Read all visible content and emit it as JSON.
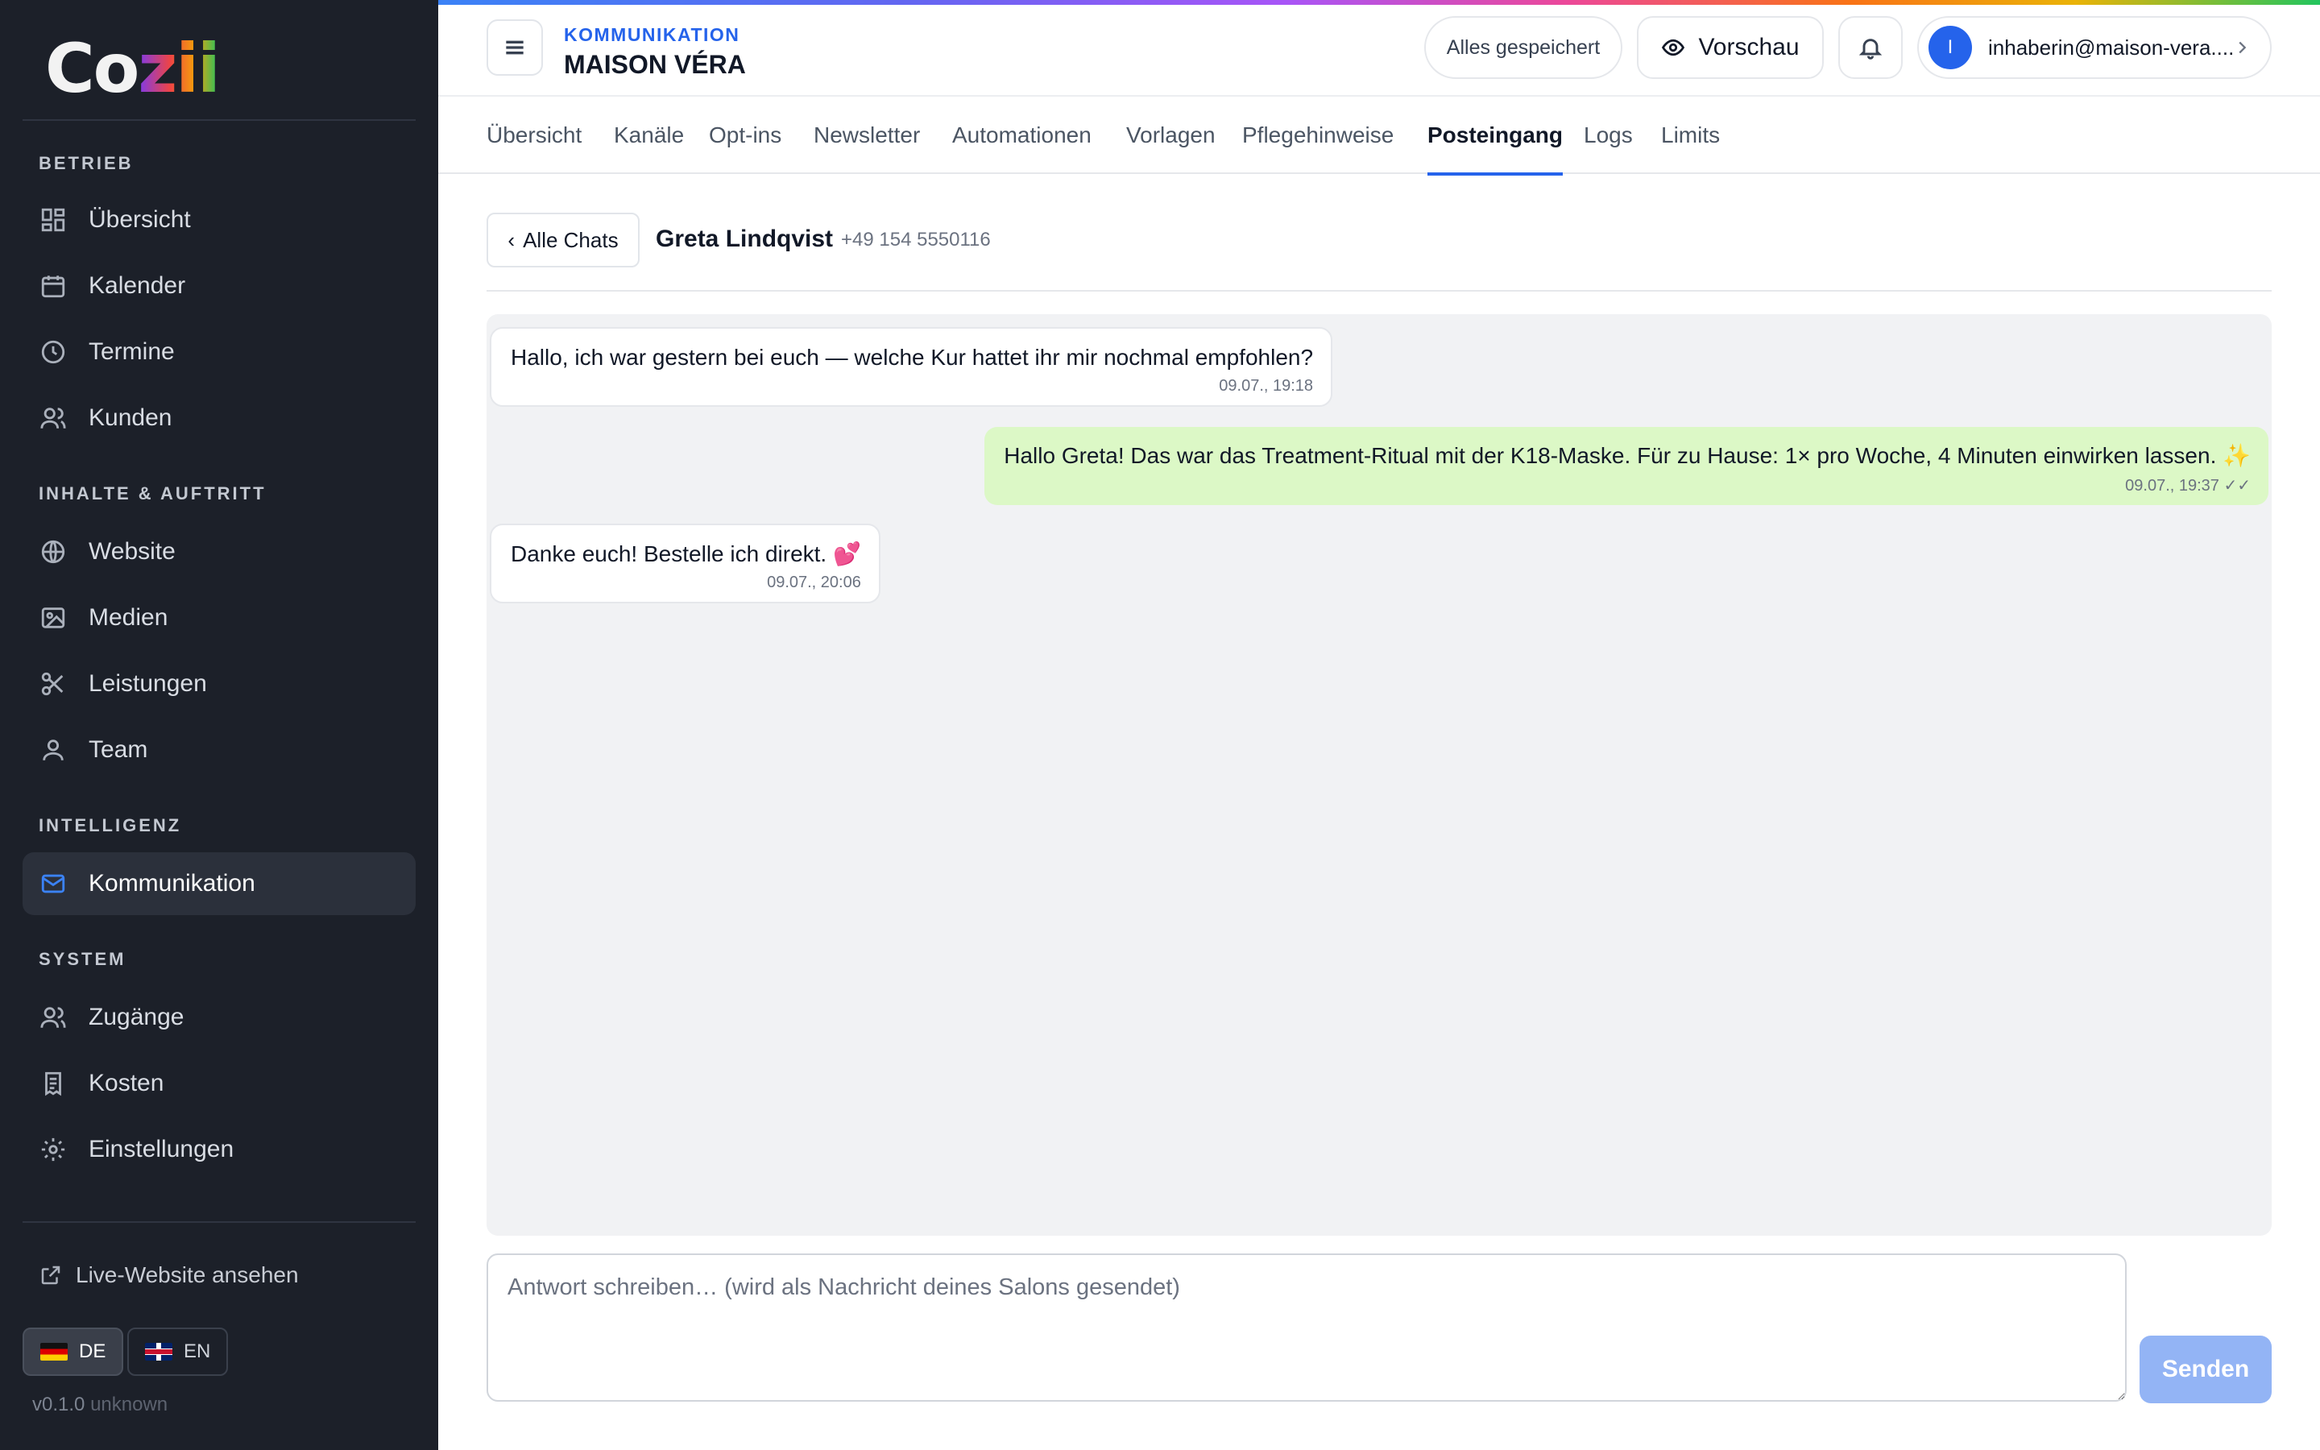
{
  "brand": {
    "logo_prefix": "Co",
    "logo_suffix": "zii"
  },
  "sidebar": {
    "sections": [
      {
        "title": "BETRIEB"
      },
      {
        "title": "INHALTE & AUFTRITT"
      },
      {
        "title": "INTELLIGENZ"
      },
      {
        "title": "SYSTEM"
      }
    ],
    "items": [
      {
        "label": "Übersicht",
        "icon": "dashboard-icon"
      },
      {
        "label": "Kalender",
        "icon": "calendar-icon"
      },
      {
        "label": "Termine",
        "icon": "clock-icon"
      },
      {
        "label": "Kunden",
        "icon": "users-icon"
      },
      {
        "label": "Website",
        "icon": "globe-icon"
      },
      {
        "label": "Medien",
        "icon": "image-icon"
      },
      {
        "label": "Leistungen",
        "icon": "scissors-icon"
      },
      {
        "label": "Team",
        "icon": "user-icon"
      },
      {
        "label": "Kommunikation",
        "icon": "mail-icon",
        "active": true
      },
      {
        "label": "Zugänge",
        "icon": "users-icon"
      },
      {
        "label": "Kosten",
        "icon": "receipt-icon"
      },
      {
        "label": "Einstellungen",
        "icon": "gear-icon"
      }
    ],
    "live_link": "Live-Website ansehen",
    "languages": [
      {
        "code": "DE",
        "active": true
      },
      {
        "code": "EN",
        "active": false
      }
    ],
    "version": "v0.1.0",
    "version_suffix": "unknown"
  },
  "topbar": {
    "section_label": "KOMMUNIKATION",
    "title": "MAISON VÉRA",
    "save_status": "Alles gespeichert",
    "preview_label": "Vorschau",
    "user_initial": "I",
    "user_email": "inhaberin@maison-vera...."
  },
  "tabs": [
    {
      "label": "Übersicht"
    },
    {
      "label": "Kanäle"
    },
    {
      "label": "Opt-ins"
    },
    {
      "label": "Newsletter"
    },
    {
      "label": "Automationen"
    },
    {
      "label": "Vorlagen"
    },
    {
      "label": "Pflegehinweise"
    },
    {
      "label": "Posteingang",
      "active": true
    },
    {
      "label": "Logs"
    },
    {
      "label": "Limits"
    }
  ],
  "chat": {
    "back_label": "Alle Chats",
    "contact_name": "Greta Lindqvist",
    "contact_phone": "+49 154 5550116",
    "messages": [
      {
        "direction": "in",
        "text": "Hallo, ich war gestern bei euch — welche Kur hattet ihr mir nochmal empfohlen?",
        "time": "09.07., 19:18"
      },
      {
        "direction": "out",
        "text": "Hallo Greta! Das war das Treatment-Ritual mit der K18-Maske. Für zu Hause: 1× pro Woche, 4 Minuten einwirken lassen. ✨",
        "time": "09.07., 19:37 ✓✓"
      },
      {
        "direction": "in",
        "text": "Danke euch! Bestelle ich direkt. 💕",
        "time": "09.07., 20:06"
      }
    ]
  },
  "composer": {
    "placeholder": "Antwort schreiben… (wird als Nachricht deines Salons gesendet)",
    "value": "",
    "send_label": "Senden"
  },
  "colors": {
    "sidebar_bg": "#1c2029",
    "accent": "#2563eb",
    "outgoing_bubble": "#dcf8c6",
    "send_disabled": "#93b4f5"
  }
}
